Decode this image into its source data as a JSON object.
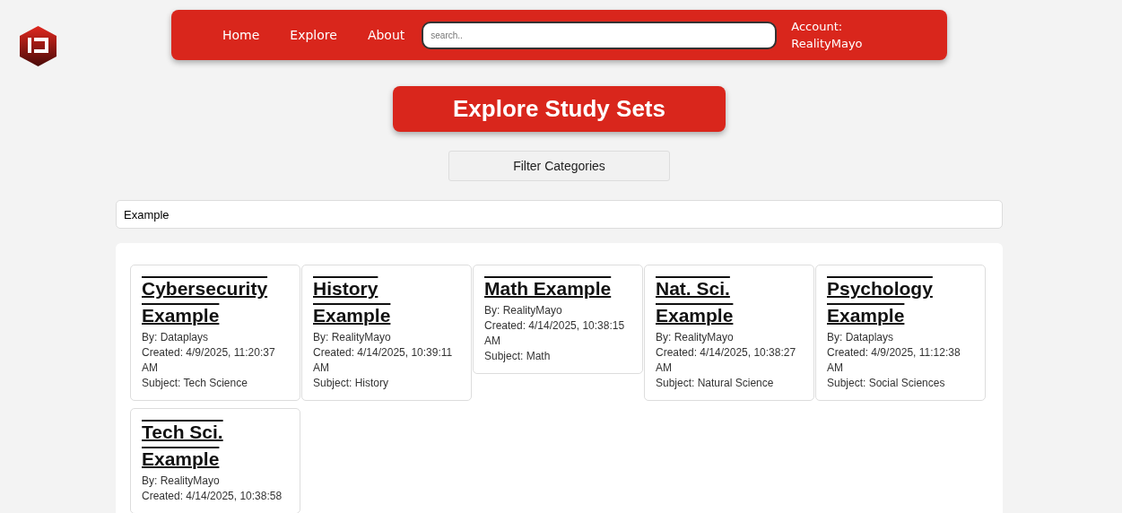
{
  "nav": {
    "links": [
      "Home",
      "Explore",
      "About"
    ],
    "search": {
      "placeholder": "search.."
    },
    "account": {
      "label": "Account:",
      "name": "RealityMayo"
    }
  },
  "heading": "Explore Study Sets",
  "filter_button": "Filter Categories",
  "search": {
    "value": "Example"
  },
  "study_sets": [
    {
      "title": "Cybersecurity Example",
      "lines": [
        "By: Dataplays",
        "Created: 4/9/2025, 11:20:37 AM",
        "Subject: Tech Science"
      ]
    },
    {
      "title": "History Example",
      "lines": [
        "By: RealityMayo",
        "Created: 4/14/2025, 10:39:11 AM",
        "Subject: History"
      ]
    },
    {
      "title": "Math Example",
      "lines": [
        "By: RealityMayo",
        "Created: 4/14/2025, 10:38:15 AM",
        "Subject: Math"
      ]
    },
    {
      "title": "Nat. Sci. Example",
      "lines": [
        "By: RealityMayo",
        "Created: 4/14/2025, 10:38:27 AM",
        "Subject: Natural Science"
      ]
    },
    {
      "title": "Psychology Example",
      "lines": [
        "By: Dataplays",
        "Created: 4/9/2025, 11:12:38 AM",
        "Subject: Social Sciences"
      ]
    },
    {
      "title": "Tech Sci. Example",
      "lines": [
        "By: RealityMayo",
        "Created: 4/14/2025, 10:38:58"
      ]
    }
  ]
}
